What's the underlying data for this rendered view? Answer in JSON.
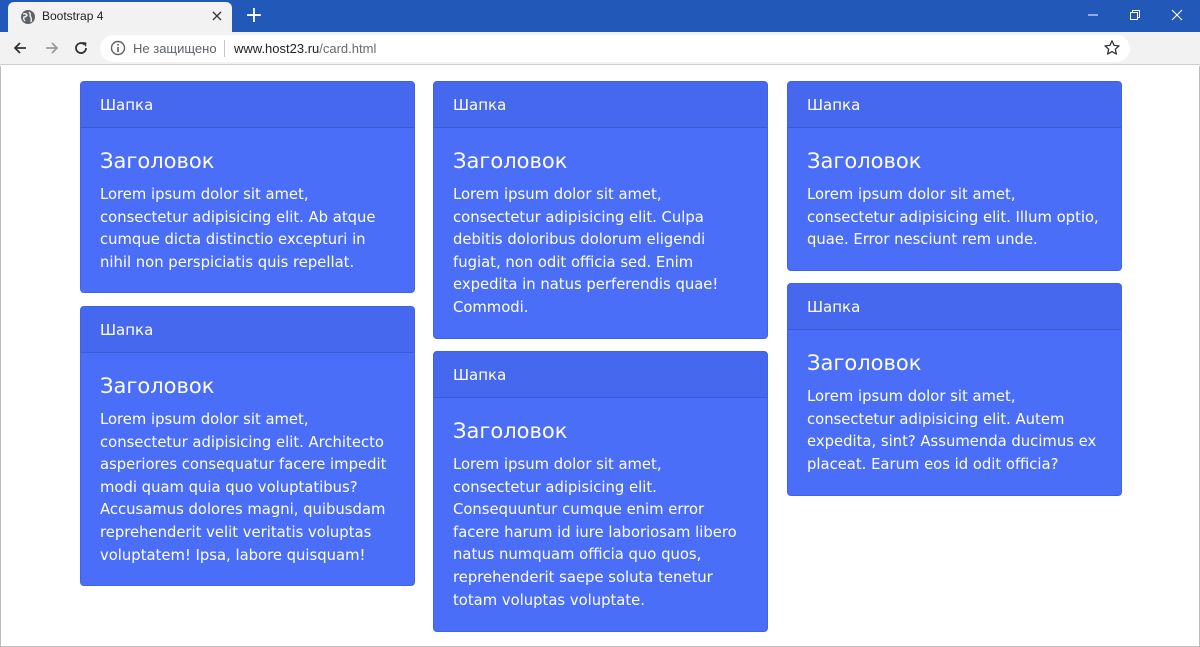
{
  "browser": {
    "tab_title": "Bootstrap 4",
    "tab_close": "×",
    "new_tab": "+",
    "security_label": "Не защищено",
    "url_host": "www.host23.ru",
    "url_path": "/card.html",
    "accent_color": "#2259b8"
  },
  "cards": [
    {
      "header": "Шапка",
      "title": "Заголовок",
      "text": "Lorem ipsum dolor sit amet, consectetur adipisicing elit. Ab atque cumque dicta distinctio excepturi in nihil non perspiciatis quis repellat."
    },
    {
      "header": "Шапка",
      "title": "Заголовок",
      "text": "Lorem ipsum dolor sit amet, consectetur adipisicing elit. Architecto asperiores consequatur facere impedit modi quam quia quo voluptatibus? Accusamus dolores magni, quibusdam reprehenderit velit veritatis voluptas voluptatem! Ipsa, labore quisquam!"
    },
    {
      "header": "Шапка",
      "title": "Заголовок",
      "text": "Lorem ipsum dolor sit amet, consectetur adipisicing elit. Culpa debitis doloribus dolorum eligendi fugiat, non odit officia sed. Enim expedita in natus perferendis quae! Commodi."
    },
    {
      "header": "Шапка",
      "title": "Заголовок",
      "text": "Lorem ipsum dolor sit amet, consectetur adipisicing elit. Consequuntur cumque enim error facere harum id iure laboriosam libero natus numquam officia quo quos, reprehenderit saepe soluta tenetur totam voluptas voluptate."
    },
    {
      "header": "Шапка",
      "title": "Заголовок",
      "text": "Lorem ipsum dolor sit amet, consectetur adipisicing elit. Illum optio, quae. Error nesciunt rem unde."
    },
    {
      "header": "Шапка",
      "title": "Заголовок",
      "text": "Lorem ipsum dolor sit amet, consectetur adipisicing elit. Autem expedita, sint? Assumenda ducimus ex placeat. Earum eos id odit officia?"
    }
  ],
  "card_color": "#4a6ef8"
}
